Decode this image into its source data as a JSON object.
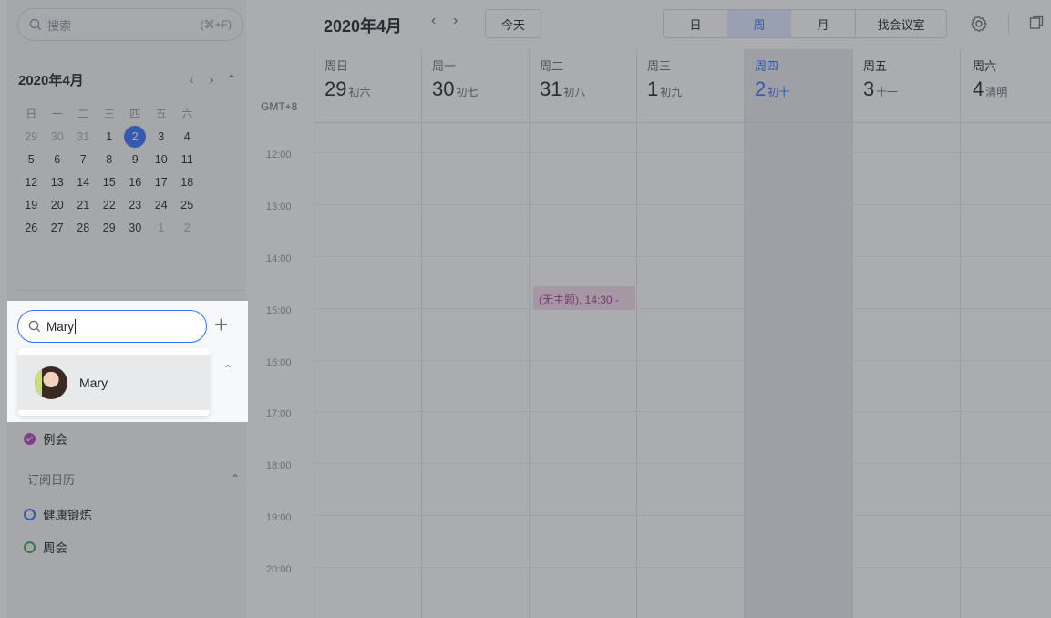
{
  "sidebar": {
    "search": {
      "placeholder": "搜索",
      "shortcut": "(⌘+F)"
    },
    "mini_calendar": {
      "title": "2020年4月",
      "weekdays": [
        "日",
        "一",
        "二",
        "三",
        "四",
        "五",
        "六"
      ],
      "weeks": [
        [
          "29",
          "30",
          "31",
          "1",
          "2",
          "3",
          "4"
        ],
        [
          "5",
          "6",
          "7",
          "8",
          "9",
          "10",
          "11"
        ],
        [
          "12",
          "13",
          "14",
          "15",
          "16",
          "17",
          "18"
        ],
        [
          "19",
          "20",
          "21",
          "22",
          "23",
          "24",
          "25"
        ],
        [
          "26",
          "27",
          "28",
          "29",
          "30",
          "1",
          "2"
        ]
      ],
      "selected": "2"
    },
    "my_calendars": [
      {
        "label": "例会",
        "color": "#b445c0"
      }
    ],
    "subscribed": {
      "title": "订阅日历",
      "items": [
        {
          "label": "健康锻炼",
          "color": "#3370ff"
        },
        {
          "label": "周会",
          "color": "#34a853"
        }
      ]
    }
  },
  "people_search": {
    "value": "Mary",
    "add_label": "+",
    "results": [
      {
        "name": "Mary"
      }
    ]
  },
  "toolbar": {
    "title": "2020年4月",
    "prev": "‹",
    "next": "›",
    "today": "今天",
    "views": [
      "日",
      "周",
      "月"
    ],
    "active_view": "周",
    "find_room": "找会议室"
  },
  "week_view": {
    "timezone": "GMT+8",
    "days": [
      {
        "dow": "周日",
        "date": "29",
        "lunar": "初六"
      },
      {
        "dow": "周一",
        "date": "30",
        "lunar": "初七"
      },
      {
        "dow": "周二",
        "date": "31",
        "lunar": "初八"
      },
      {
        "dow": "周三",
        "date": "1",
        "lunar": "初九"
      },
      {
        "dow": "周四",
        "date": "2",
        "lunar": "初十",
        "today": true
      },
      {
        "dow": "周五",
        "date": "3",
        "lunar": "十一"
      },
      {
        "dow": "周六",
        "date": "4",
        "lunar": "清明"
      }
    ],
    "hours": [
      "12:00",
      "13:00",
      "14:00",
      "15:00",
      "16:00",
      "17:00",
      "18:00",
      "19:00",
      "20:00"
    ],
    "events": [
      {
        "title": "(无主题)",
        "time": "14:30 -",
        "day": "周二",
        "color": "#a5388e"
      }
    ]
  }
}
